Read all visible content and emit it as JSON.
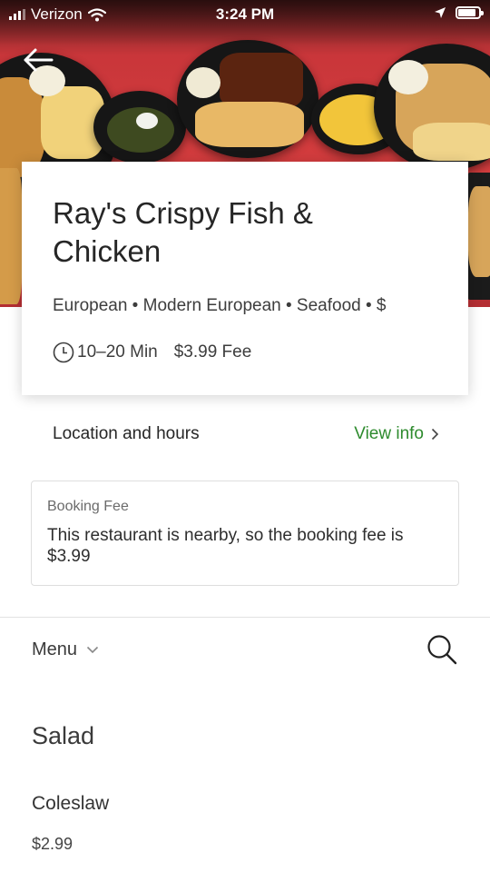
{
  "status_bar": {
    "carrier": "Verizon",
    "time": "3:24 PM",
    "battery_level": 0.85
  },
  "icons": {
    "back": "arrow-left-icon",
    "clock": "clock-icon",
    "chevron_right": "chevron-right-icon",
    "chevron_down": "chevron-down-icon",
    "search": "search-icon",
    "location": "location-arrow-icon",
    "wifi": "wifi-icon",
    "signal": "signal-bars-icon",
    "battery": "battery-icon"
  },
  "restaurant": {
    "name": "Ray's Crispy Fish & Chicken",
    "cuisine": "European • Modern European • Seafood • $",
    "delivery_time": "10–20 Min",
    "fee": "$3.99 Fee"
  },
  "location": {
    "label": "Location and hours",
    "link": "View info"
  },
  "booking": {
    "label": "Booking Fee",
    "text": "This restaurant is nearby, so the booking fee is $3.99"
  },
  "menu": {
    "label": "Menu",
    "sections": [
      {
        "title": "Salad",
        "items": [
          {
            "name": "Coleslaw",
            "price": "$2.99"
          }
        ]
      }
    ]
  },
  "colors": {
    "accent_green": "#2e8b2e",
    "hero_red": "#d63e3f",
    "text_dark": "#262626"
  }
}
